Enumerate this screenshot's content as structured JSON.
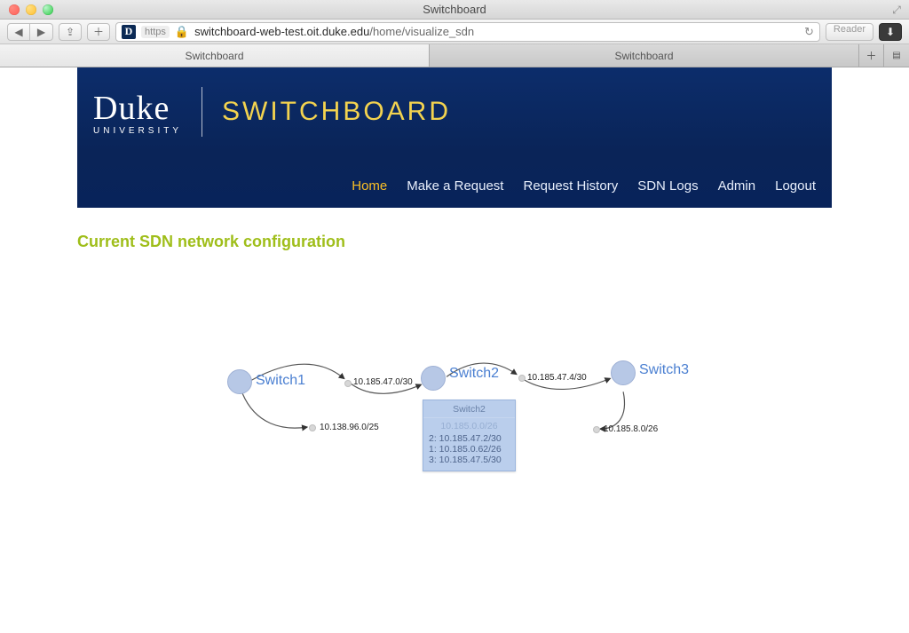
{
  "window": {
    "title": "Switchboard"
  },
  "browser": {
    "url_scheme": "https",
    "url_host": "switchboard-web-test.oit.duke.edu",
    "url_path": "/home/visualize_sdn",
    "reader_label": "Reader",
    "tabs": [
      {
        "label": "Switchboard",
        "active": true
      },
      {
        "label": "Switchboard",
        "active": false
      }
    ]
  },
  "header": {
    "logo": {
      "main": "Duke",
      "sub": "UNIVERSITY"
    },
    "app_title": "SWITCHBOARD",
    "nav": {
      "home": "Home",
      "request": "Make a Request",
      "history": "Request History",
      "logs": "SDN Logs",
      "admin": "Admin",
      "logout": "Logout"
    }
  },
  "page": {
    "section_title": "Current SDN network configuration"
  },
  "diagram": {
    "switches": {
      "s1": "Switch1",
      "s2": "Switch2",
      "s3": "Switch3"
    },
    "links": {
      "l1": "10.185.47.0/30",
      "l2": "10.185.47.4/30",
      "l3": "10.138.96.0/25",
      "l4": "10.185.8.0/26"
    },
    "tooltip": {
      "title": "Switch2",
      "muted": "10.185.0.0/26",
      "rows": [
        "2: 10.185.47.2/30",
        "1: 10.185.0.62/26",
        "3: 10.185.47.5/30"
      ]
    }
  }
}
